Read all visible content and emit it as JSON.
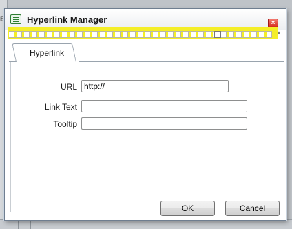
{
  "background": {
    "left_fragment": "B"
  },
  "dialog": {
    "title": "Hyperlink Manager",
    "close_label": "×",
    "tabs": [
      {
        "label": "Hyperlink",
        "selected": true
      }
    ],
    "fields": {
      "url": {
        "label": "URL",
        "value": "http://"
      },
      "link_text": {
        "label": "Link Text",
        "value": ""
      },
      "tooltip": {
        "label": "Tooltip",
        "value": ""
      }
    },
    "buttons": {
      "ok": "OK",
      "cancel": "Cancel"
    }
  },
  "colors": {
    "toolbar_highlight": "#f4ee27",
    "close_button": "#d5281c",
    "dialog_border": "#6f7e90"
  }
}
